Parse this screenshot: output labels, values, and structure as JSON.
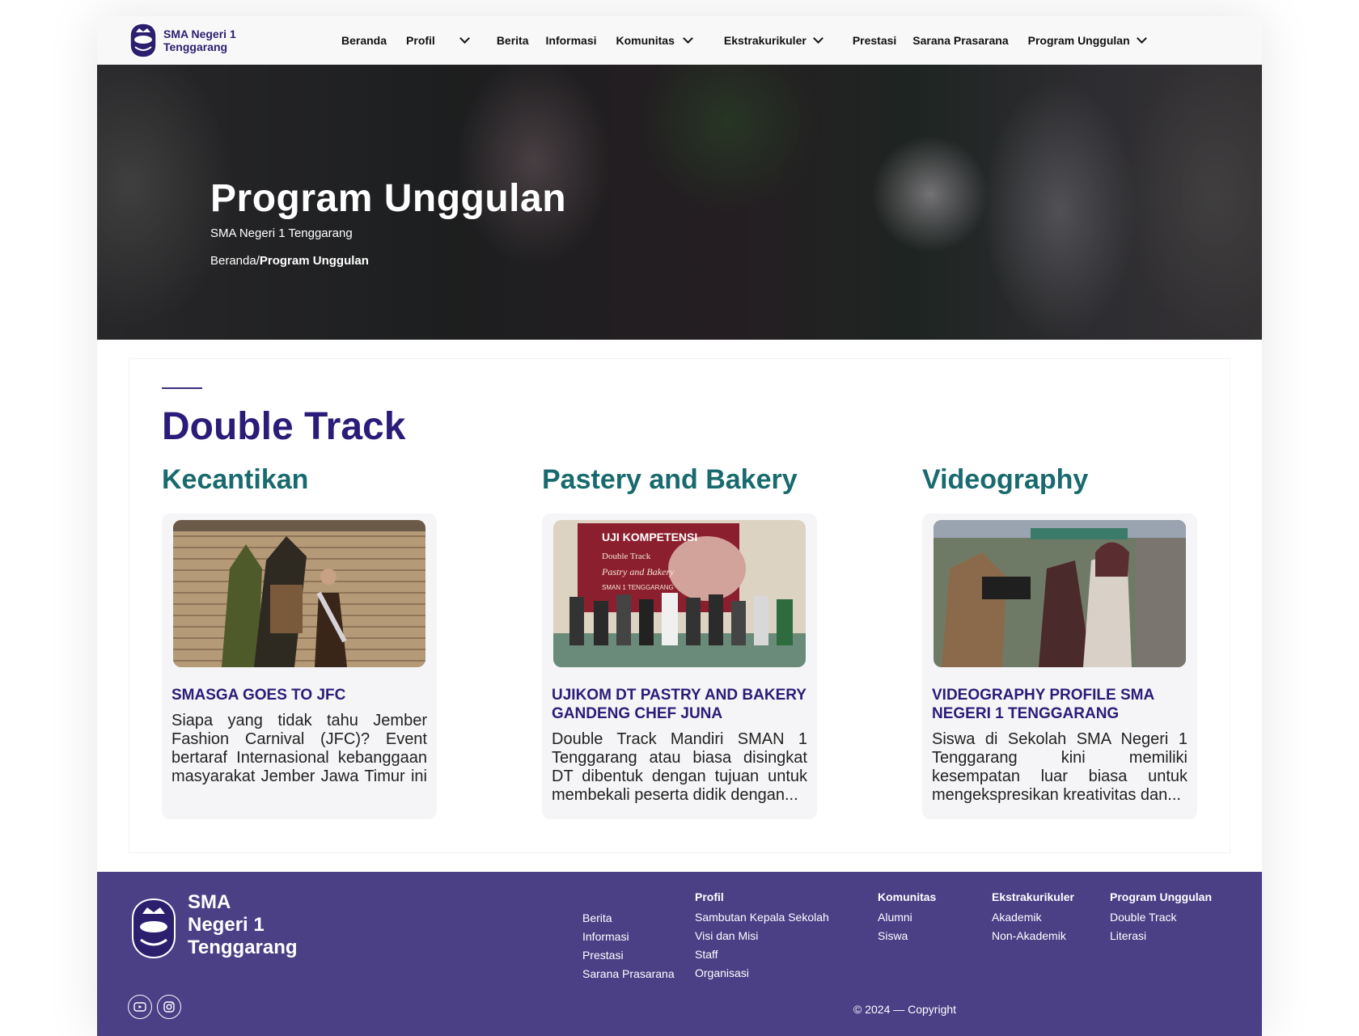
{
  "brand": {
    "line1": "SMA Negeri 1",
    "line2": "Tenggarang"
  },
  "nav": {
    "items": [
      {
        "label": "Beranda",
        "has_dropdown": false
      },
      {
        "label": "Profil",
        "has_dropdown": true
      },
      {
        "label": "Berita",
        "has_dropdown": false
      },
      {
        "label": "Informasi",
        "has_dropdown": false
      },
      {
        "label": "Komunitas",
        "has_dropdown": true
      },
      {
        "label": "Ekstrakurikuler",
        "has_dropdown": true
      },
      {
        "label": "Prestasi",
        "has_dropdown": false
      },
      {
        "label": "Sarana Prasarana",
        "has_dropdown": false
      },
      {
        "label": "Program Unggulan",
        "has_dropdown": true
      }
    ]
  },
  "hero": {
    "title": "Program Unggulan",
    "subtitle": "SMA Negeri 1 Tenggarang",
    "breadcrumb_home": "Beranda/",
    "breadcrumb_current": "Program Unggulan"
  },
  "section": {
    "title": "Double Track",
    "columns": [
      {
        "heading": "Kecantikan",
        "card": {
          "title": "SMASGA GOES TO JFC",
          "body": "Siapa yang tidak tahu Jember Fashion Carnival (JFC)? Event bertaraf Internasional kebanggaan masyarakat Jember Jawa Timur ini menyuguhkan Parade Karnaval d.."
        }
      },
      {
        "heading": "Pastery and Bakery",
        "card": {
          "title": "UJIKOM DT PASTRY AND BAKERY GANDENG CHEF JUNA",
          "body": "Double Track Mandiri SMAN 1 Tenggarang atau biasa disingkat DT dibentuk dengan tujuan untuk membekali peserta didik dengan...",
          "image_text": {
            "banner": "UJI KOMPETENSI",
            "line2": "Double Track",
            "line3": "Pastry and Bakery",
            "line4": "SMAN 1 TENGGARANG"
          }
        }
      },
      {
        "heading": "Videography",
        "card": {
          "title": "VIDEOGRAPHY PROFILE SMA NEGERI 1 TENGGARANG",
          "body": "Siswa di Sekolah SMA Negeri 1 Tenggarang kini memiliki kesempatan luar biasa untuk mengekspresikan kreativitas dan..."
        }
      }
    ]
  },
  "footer": {
    "brand": [
      "SMA",
      "Negeri 1",
      "Tenggarang"
    ],
    "links_col": [
      "Berita",
      "Informasi",
      "Prestasi",
      "Sarana Prasarana"
    ],
    "profil": {
      "heading": "Profil",
      "items": [
        "Sambutan Kepala Sekolah",
        "Visi dan Misi",
        "Staff",
        "Organisasi"
      ]
    },
    "komunitas": {
      "heading": "Komunitas",
      "items": [
        "Alumni",
        "Siswa"
      ]
    },
    "ekstra": {
      "heading": "Ekstrakurikuler",
      "items": [
        "Akademik",
        "Non-Akademik"
      ]
    },
    "program": {
      "heading": "Program Unggulan",
      "items": [
        "Double Track",
        "Literasi"
      ]
    },
    "copyright": "© 2024 — Copyright",
    "social": [
      "youtube-icon",
      "instagram-icon"
    ]
  },
  "colors": {
    "brand_purple": "#2a1c78",
    "teal_heading": "#186a6e",
    "footer_bg": "#4b3f86"
  }
}
